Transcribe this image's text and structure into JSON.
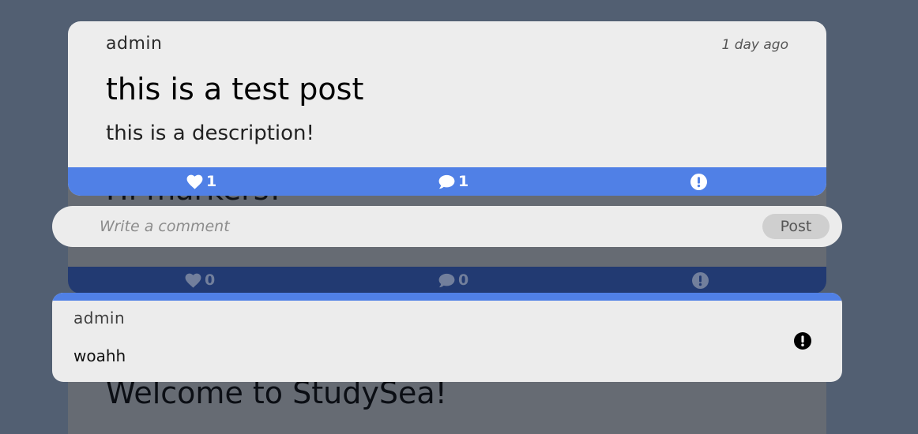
{
  "background_feed": {
    "post_1": {
      "title": "Hi markers!",
      "likes": "0",
      "comments": "0"
    },
    "post_2": {
      "title": "Welcome to StudySea!"
    }
  },
  "focused_post": {
    "author": "admin",
    "time": "1 day ago",
    "title": "this is a test post",
    "description": "this is a description!",
    "likes": "1",
    "comments": "1"
  },
  "comment_form": {
    "placeholder": "Write a comment",
    "submit_label": "Post"
  },
  "comment": {
    "author": "admin",
    "text": "woahh"
  },
  "icons": {
    "like": "heart-icon",
    "comment": "comment-icon",
    "report": "exclamation-circle-icon"
  },
  "colors": {
    "page_background": "#525f72",
    "card_background": "#ededed",
    "accent": "#5080e6",
    "dimmed_accent": "#223a72"
  }
}
